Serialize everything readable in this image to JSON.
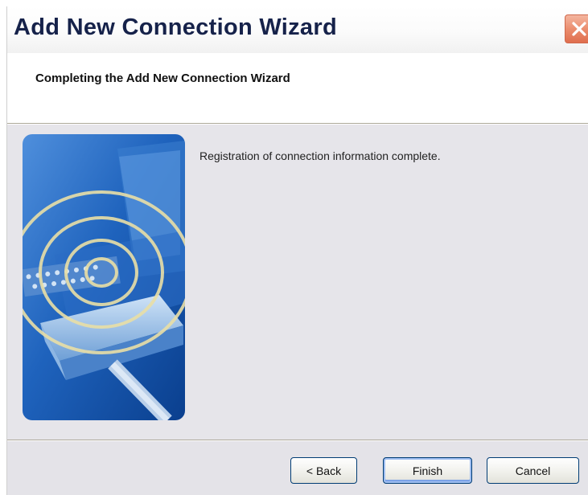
{
  "window": {
    "title": "Add New Connection Wizard"
  },
  "header": {
    "title": "Completing the Add New Connection Wizard"
  },
  "content": {
    "message": "Registration of connection information complete."
  },
  "buttons": {
    "back": "< Back",
    "finish": "Finish",
    "cancel": "Cancel"
  },
  "icons": {
    "close": "close-icon",
    "illustration": "wireless-connection-illustration"
  },
  "colors": {
    "title_text": "#16224a",
    "close_button": "#e87d5c",
    "illustration_blue": "#1b5fb8",
    "dialog_background": "#e6e5ea",
    "default_button_highlight": "#7ba2e7"
  }
}
